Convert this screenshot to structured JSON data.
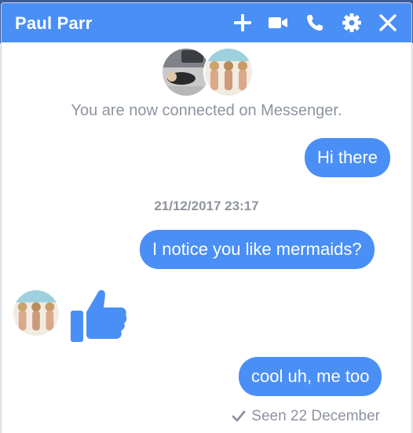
{
  "chat": {
    "title": "Paul Parr",
    "connected_text": "You are now connected on Messenger.",
    "accent_color": "#4a8ff5"
  },
  "header_icons": [
    "add-icon",
    "video-call-icon",
    "phone-icon",
    "settings-icon",
    "close-icon"
  ],
  "messages": [
    {
      "text": "Hi there"
    },
    {
      "text": "I notice you like mermaids?"
    },
    {
      "text": "cool uh, me too"
    }
  ],
  "timestamp": "21/12/2017 23:17",
  "received_sticker": "thumbs-up-icon",
  "seen": {
    "text": "Seen 22 December"
  }
}
